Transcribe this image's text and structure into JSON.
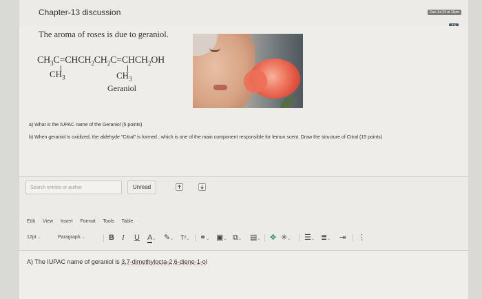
{
  "header": {
    "title": "Chapter-13 discussion",
    "due": "Due Jul 24 at 11pm",
    "badge": "10"
  },
  "post": {
    "question": "The aroma of roses is due to geraniol.",
    "molecule_name": "Geraniol",
    "photo_icon": "rose-photo",
    "part_a": "a) What is the IUPAC name of the Geraniol (5 points)",
    "part_b": "b) When geraniol is oxidized, the aldehyde \"Citral\" is formed , which is one of the main component responsible for lemon scent. Draw the structure of Citral (15 points)"
  },
  "controls": {
    "search_placeholder": "Search entries or author",
    "unread_label": "Unread"
  },
  "editor": {
    "menu": [
      "Edit",
      "View",
      "Insert",
      "Format",
      "Tools",
      "Table"
    ],
    "font_size": "12pt",
    "block_format": "Paragraph",
    "answer_prefix": "A) The IUPAC name of geraniol is ",
    "answer_value": "3,7-dimethylocta-2,6-diene-1-ol"
  }
}
